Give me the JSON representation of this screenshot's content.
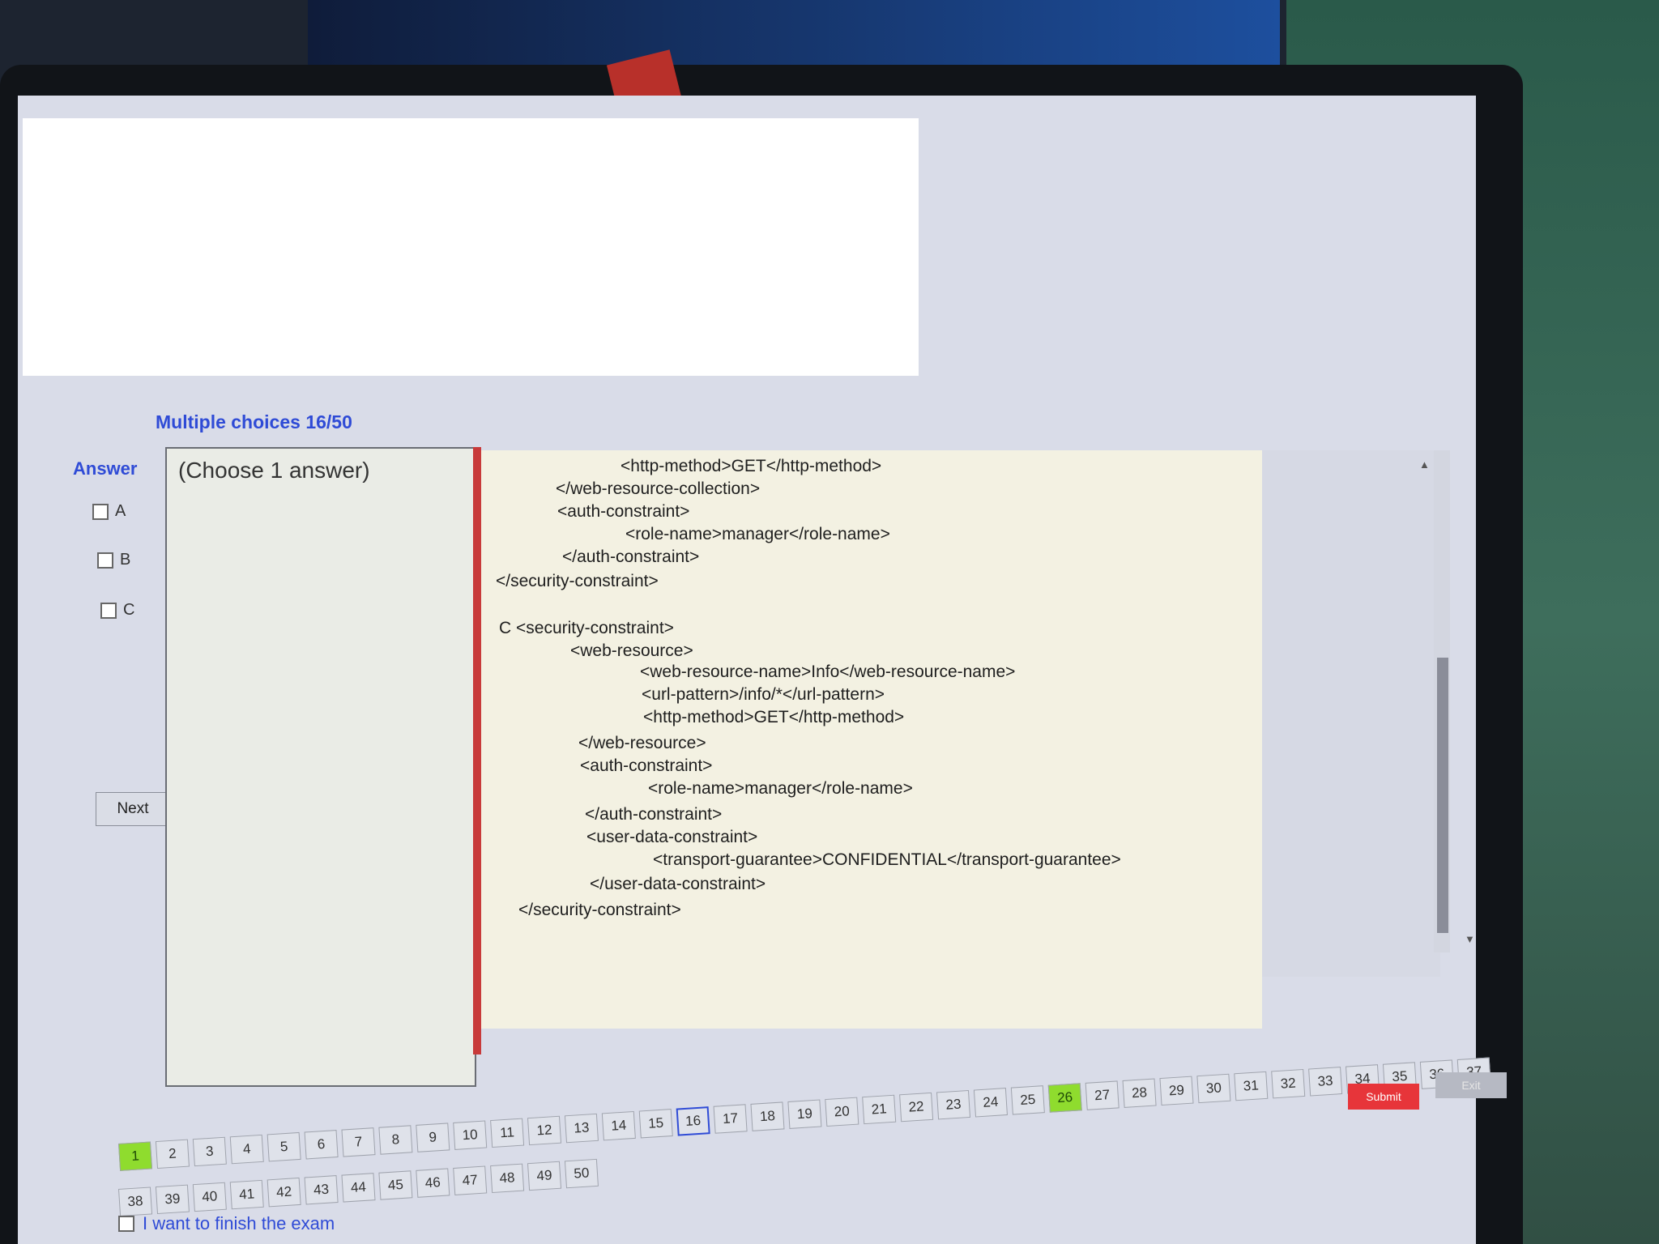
{
  "header": {
    "title": "Multiple choices 16/50"
  },
  "answer_panel": {
    "label": "Answer",
    "options": [
      "A",
      "B",
      "C"
    ],
    "next_label": "Next"
  },
  "question": {
    "instruction": "(Choose 1 answer)"
  },
  "code": {
    "lines": [
      "<http-method>GET</http-method>",
      "</web-resource-collection>",
      "<auth-constraint>",
      "<role-name>manager</role-name>",
      "</auth-constraint>",
      "</security-constraint>",
      "C <security-constraint>",
      "<web-resource>",
      "<web-resource-name>Info</web-resource-name>",
      "<url-pattern>/info/*</url-pattern>",
      "<http-method>GET</http-method>",
      "</web-resource>",
      "<auth-constraint>",
      "<role-name>manager</role-name>",
      "</auth-constraint>",
      "<user-data-constraint>",
      "<transport-guarantee>CONFIDENTIAL</transport-guarantee>",
      "</user-data-constraint>",
      "</security-constraint>"
    ]
  },
  "navigation": {
    "row1": [
      "1",
      "2",
      "3",
      "4",
      "5",
      "6",
      "7",
      "8",
      "9",
      "10",
      "11",
      "12",
      "13",
      "14",
      "15",
      "16",
      "17",
      "18",
      "19",
      "20",
      "21",
      "22",
      "23",
      "24",
      "25",
      "26",
      "27",
      "28",
      "29",
      "30",
      "31",
      "32",
      "33",
      "34",
      "35",
      "36",
      "37"
    ],
    "row2": [
      "38",
      "39",
      "40",
      "41",
      "42",
      "43",
      "44",
      "45",
      "46",
      "47",
      "48",
      "49",
      "50"
    ],
    "current": "16",
    "answered": [
      "1",
      "26"
    ]
  },
  "actions": {
    "submit_label": "Submit",
    "exit_label": "Exit",
    "finish_label": "I want to finish the exam"
  },
  "colors": {
    "accent": "#2f4bd6",
    "answered": "#8fdc2e",
    "submit": "#e7353a",
    "code_bg": "#f3f1e2"
  }
}
